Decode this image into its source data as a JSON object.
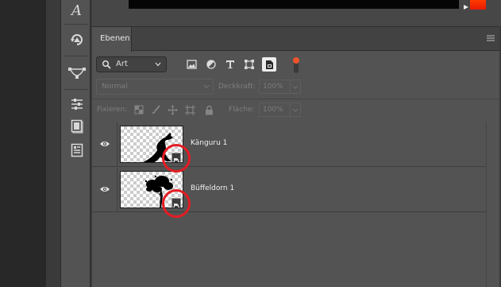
{
  "panel": {
    "tab_label": "Ebenen"
  },
  "filter": {
    "kind_label": "Art"
  },
  "blend": {
    "mode": "Normal",
    "opacity_label": "Deckkraft:",
    "opacity_value": "100%",
    "fill_label": "Fläche:",
    "fill_value": "100%",
    "lock_label": "Fixieren:"
  },
  "layers": [
    {
      "name": "Känguru 1",
      "visible": true,
      "smart_object": true,
      "highlighted": true
    },
    {
      "name": "Büffeldorn 1",
      "visible": true,
      "smart_object": true,
      "highlighted": true
    }
  ],
  "toolbar": {
    "tools": [
      "type-tool-icon",
      "history-icon",
      "paths-icon",
      "adjustments-icon",
      "properties-icon",
      "libraries-icon"
    ]
  },
  "colors": {
    "highlight_ring": "#e51c23",
    "canvas_swatch": "#ff3a00",
    "panel_bg": "#535353"
  }
}
